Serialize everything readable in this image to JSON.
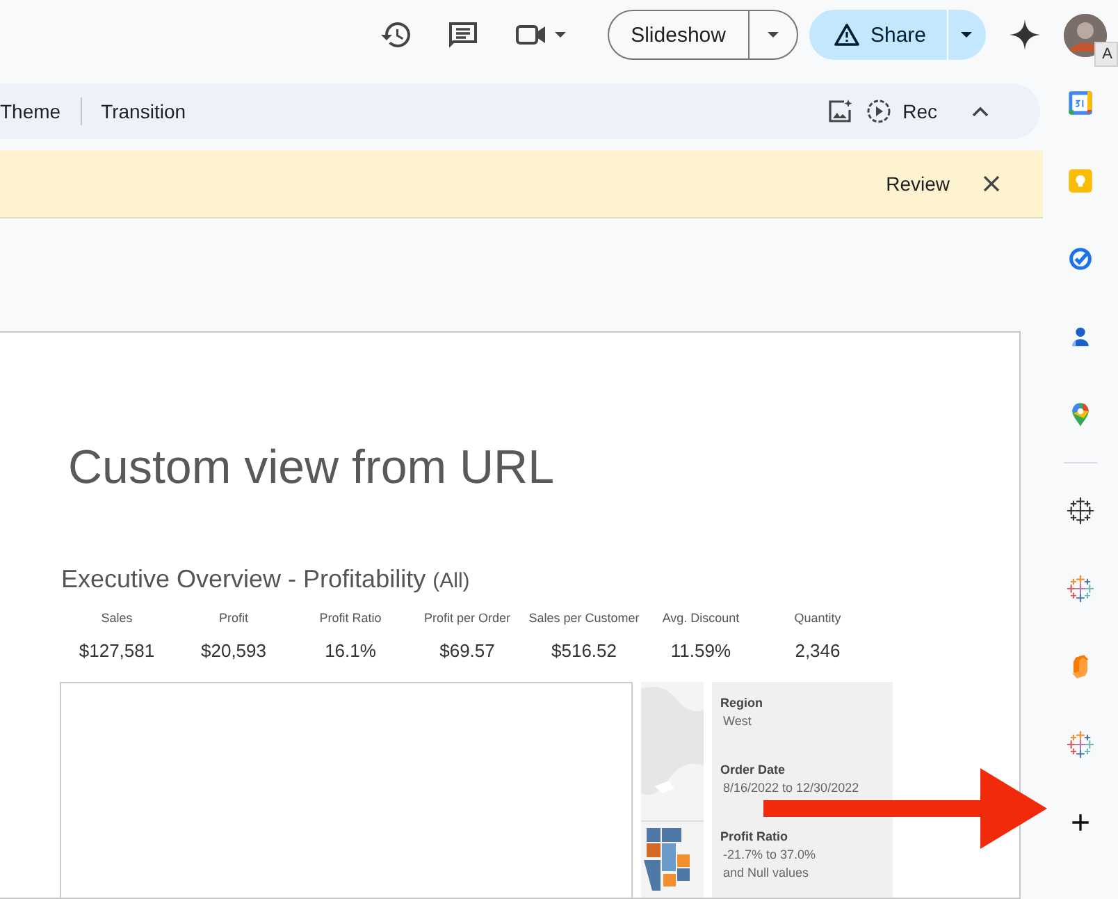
{
  "top_bar": {
    "slideshow_button": "Slideshow",
    "share_button": "Share",
    "tooltip": "A"
  },
  "toolbar": {
    "items": [
      "Theme",
      "Transition"
    ],
    "rec_button": "Rec"
  },
  "banner": {
    "review_button": "Review"
  },
  "slide": {
    "title": "Custom view from URL",
    "dashboard": {
      "title": "Executive Overview - Profitability",
      "qualifier": "(All)",
      "kpis": [
        {
          "label": "Sales",
          "value": "$127,581"
        },
        {
          "label": "Profit",
          "value": "$20,593"
        },
        {
          "label": "Profit Ratio",
          "value": "16.1%"
        },
        {
          "label": "Profit per Order",
          "value": "$69.57"
        },
        {
          "label": "Sales per Customer",
          "value": "$516.52"
        },
        {
          "label": "Avg. Discount",
          "value": "11.59%"
        },
        {
          "label": "Quantity",
          "value": "2,346"
        }
      ],
      "filters": [
        {
          "label": "Region",
          "values": [
            "West"
          ]
        },
        {
          "label": "Order Date",
          "values": [
            "8/16/2022 to 12/30/2022"
          ]
        },
        {
          "label": "Profit Ratio",
          "values": [
            "-21.7% to 37.0%",
            "and Null values"
          ]
        }
      ]
    }
  }
}
